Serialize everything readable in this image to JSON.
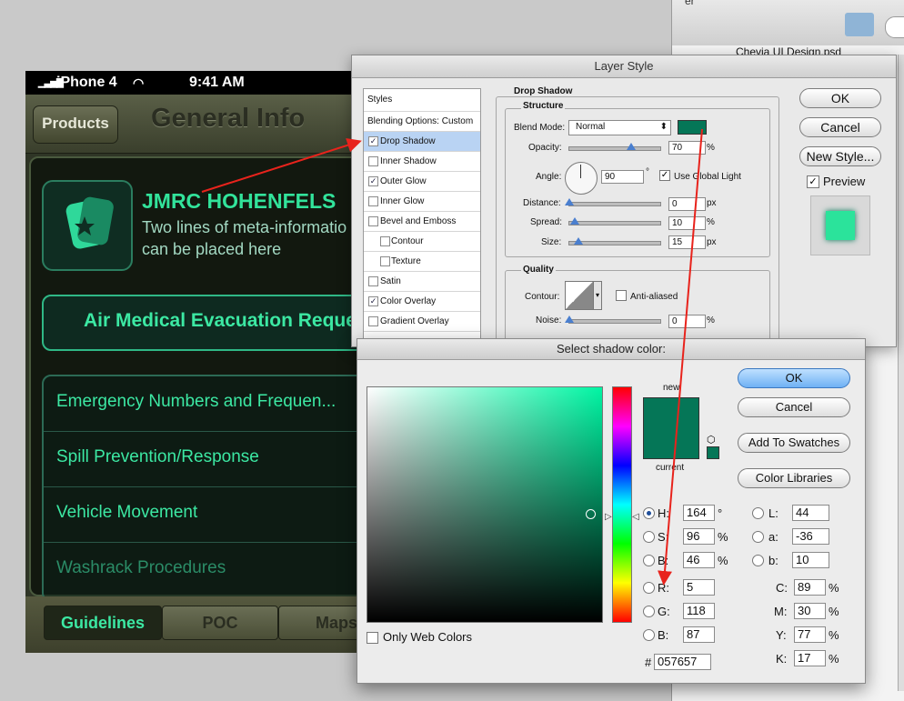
{
  "finder": {
    "top_text": "er",
    "file_name": "Chevia UI Design.psd"
  },
  "iphone": {
    "carrier": "iPhone 4",
    "time": "9:41 AM",
    "nav": {
      "back_label": "Products",
      "title": "General Info"
    },
    "header": {
      "title": "JMRC HOHENFELS",
      "meta_line1": "Two lines of meta-informatio",
      "meta_line2": "can be placed here"
    },
    "primary_button": "Air Medical Evacuation Reques",
    "list_items": [
      "Emergency Numbers and Frequen...",
      "Spill Prevention/Response",
      "Vehicle Movement",
      "Washrack Procedures"
    ],
    "tabs": [
      "Guidelines",
      "POC",
      "Maps"
    ]
  },
  "layer_style": {
    "title": "Layer Style",
    "styles_header": "Styles",
    "blending": "Blending Options: Custom",
    "style_items": [
      {
        "label": "Drop Shadow",
        "checked": true
      },
      {
        "label": "Inner Shadow",
        "checked": false
      },
      {
        "label": "Outer Glow",
        "checked": true
      },
      {
        "label": "Inner Glow",
        "checked": false
      },
      {
        "label": "Bevel and Emboss",
        "checked": false
      },
      {
        "label": "Contour",
        "checked": false
      },
      {
        "label": "Texture",
        "checked": false
      },
      {
        "label": "Satin",
        "checked": false
      },
      {
        "label": "Color Overlay",
        "checked": true
      },
      {
        "label": "Gradient Overlay",
        "checked": false
      }
    ],
    "drop_shadow": {
      "group_title": "Drop Shadow",
      "structure_title": "Structure",
      "blend_mode_label": "Blend Mode:",
      "blend_mode_value": "Normal",
      "opacity_label": "Opacity:",
      "opacity_value": "70",
      "opacity_unit": "%",
      "angle_label": "Angle:",
      "angle_value": "90",
      "angle_unit": "°",
      "global_light_label": "Use Global Light",
      "distance_label": "Distance:",
      "distance_value": "0",
      "distance_unit": "px",
      "spread_label": "Spread:",
      "spread_value": "10",
      "spread_unit": "%",
      "size_label": "Size:",
      "size_value": "15",
      "size_unit": "px",
      "quality_title": "Quality",
      "contour_label": "Contour:",
      "anti_aliased_label": "Anti-aliased",
      "noise_label": "Noise:",
      "noise_value": "0",
      "noise_unit": "%",
      "shadow_color": "#057657"
    },
    "buttons": {
      "ok": "OK",
      "cancel": "Cancel",
      "new_style": "New Style...",
      "preview": "Preview"
    },
    "preview_color": "#2be39b"
  },
  "color_picker": {
    "title": "Select shadow color:",
    "new_label": "new",
    "current_label": "current",
    "buttons": {
      "ok": "OK",
      "cancel": "Cancel",
      "add_swatches": "Add To Swatches",
      "color_libraries": "Color Libraries"
    },
    "only_web_colors": "Only Web Colors",
    "hsb": {
      "h_label": "H:",
      "h": "164",
      "h_unit": "°",
      "s_label": "S:",
      "s": "96",
      "s_unit": "%",
      "b_label": "B:",
      "b": "46",
      "b_unit": "%"
    },
    "rgb": {
      "r_label": "R:",
      "r": "5",
      "g_label": "G:",
      "g": "118",
      "b_label": "B:",
      "b": "87"
    },
    "lab": {
      "l_label": "L:",
      "l": "44",
      "a_label": "a:",
      "a": "-36",
      "b_label": "b:",
      "b": "10"
    },
    "cmyk": {
      "c_label": "C:",
      "c": "89",
      "m_label": "M:",
      "m": "30",
      "y_label": "Y:",
      "y": "77",
      "k_label": "K:",
      "k": "17",
      "unit": "%"
    },
    "hex_label": "#",
    "hex": "057657",
    "color": "#057657"
  }
}
